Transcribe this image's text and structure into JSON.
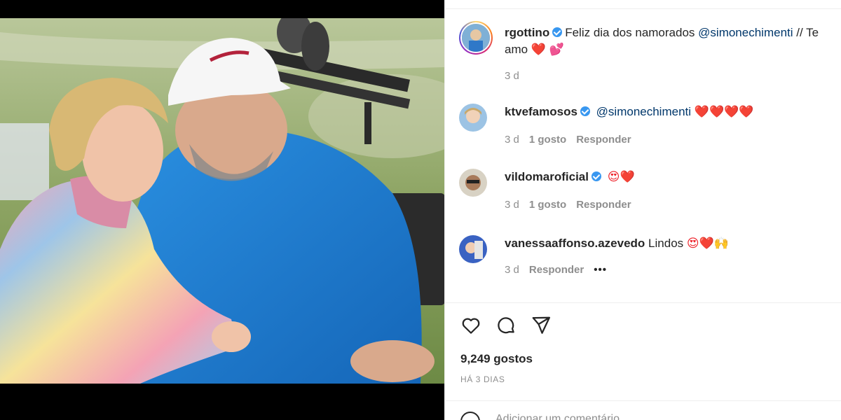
{
  "post": {
    "author": "rgottino",
    "caption_text": "Feliz dia dos namorados",
    "caption_mention": "@simonechimenti",
    "caption_tail": "// Te",
    "caption_line2": "amo",
    "caption_emoji1": "❤️",
    "caption_emoji2": "💕",
    "time": "3 d"
  },
  "comments": [
    {
      "username": "ktvefamosos",
      "verified": true,
      "mention": "@simonechimenti",
      "text": "",
      "emoji": "❤️❤️❤️❤️",
      "time": "3 d",
      "likes": "1 gosto",
      "reply": "Responder"
    },
    {
      "username": "vildomaroficial",
      "verified": true,
      "mention": "",
      "text": "",
      "emoji": "😍❤️",
      "time": "3 d",
      "likes": "1 gosto",
      "reply": "Responder"
    },
    {
      "username": "vanessaaffonso.azevedo",
      "verified": false,
      "mention": "",
      "text": "Lindos",
      "emoji": "😍❤️🙌",
      "time": "3 d",
      "likes": "",
      "reply": "Responder",
      "more": "•••"
    }
  ],
  "actions": {
    "like_icon": "heart-outline-icon",
    "comment_icon": "comment-bubble-icon",
    "share_icon": "paper-plane-icon"
  },
  "stats": {
    "likes": "9,249 gostos",
    "date": "HÁ 3 DIAS"
  },
  "composer": {
    "placeholder": "Adicionar um comentário...",
    "icon": "smiley-icon"
  },
  "colors": {
    "verified": "#3897f0",
    "mention": "#00376b",
    "muted": "#8e8e8e",
    "heart": "#ed1c24"
  }
}
